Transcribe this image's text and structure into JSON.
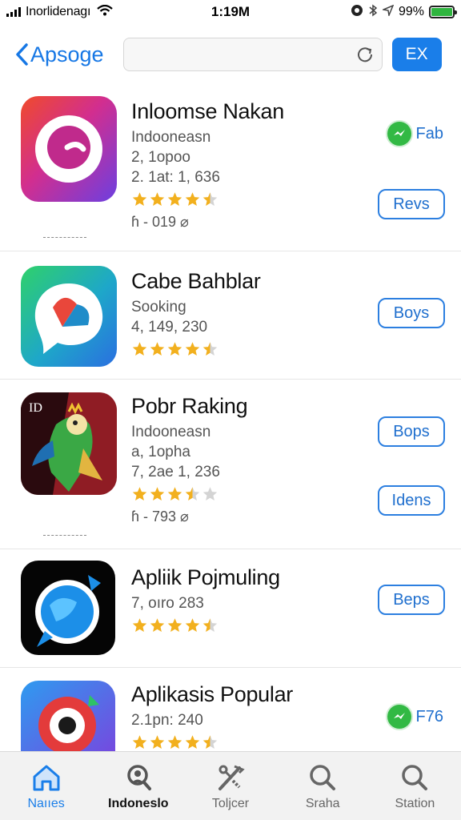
{
  "status": {
    "carrier": "Inorlidenagı",
    "time": "1:19M",
    "battery": "99%",
    "battery_level": 0.99,
    "battery_color": "#2fb53f"
  },
  "nav": {
    "back_label": "Apsoge",
    "ex_button": "EX",
    "accent": "#1a7ee9"
  },
  "apps": [
    {
      "name": "Inloomse Nakan",
      "lines": [
        "Indooneasn",
        "2, 1opoo",
        "2. 1at: 1, 636"
      ],
      "rating": 4.5,
      "extra": "ɦ - 019 ⌀",
      "icon": "circle-logo-icon",
      "message_button": "Fab",
      "button": "Revs"
    },
    {
      "name": "Cabe Bahblar",
      "lines": [
        "Sooking",
        "4, 149, 230"
      ],
      "rating": 4.5,
      "icon": "chat-bubble-icon",
      "button": "Boys"
    },
    {
      "name": "Pobr Raking",
      "lines": [
        "Indooneasn",
        "a, 1opha",
        "7, 2ae 1, 236"
      ],
      "rating": 3.5,
      "extra": "ɦ - 793 ⌀",
      "icon": "bird-character-icon",
      "button": "Bops",
      "button2": "Idens"
    },
    {
      "name": "Apliik Pojmuling",
      "lines": [
        "7, oıro 283"
      ],
      "rating": 4.5,
      "icon": "blue-planet-icon",
      "button": "Beps"
    },
    {
      "name": "Aplikasis Popular",
      "lines": [
        "2.1pn: 240"
      ],
      "rating": 4.5,
      "icon": "camera-lens-icon",
      "message_button": "F76"
    }
  ],
  "tabs": [
    {
      "label": "Naııes",
      "icon": "home-icon",
      "active": true
    },
    {
      "label": "Indoneslo",
      "icon": "person-search-icon"
    },
    {
      "label": "Toljcer",
      "icon": "tools-icon"
    },
    {
      "label": "Sraha",
      "icon": "search-icon"
    },
    {
      "label": "Station",
      "icon": "search-icon"
    }
  ]
}
